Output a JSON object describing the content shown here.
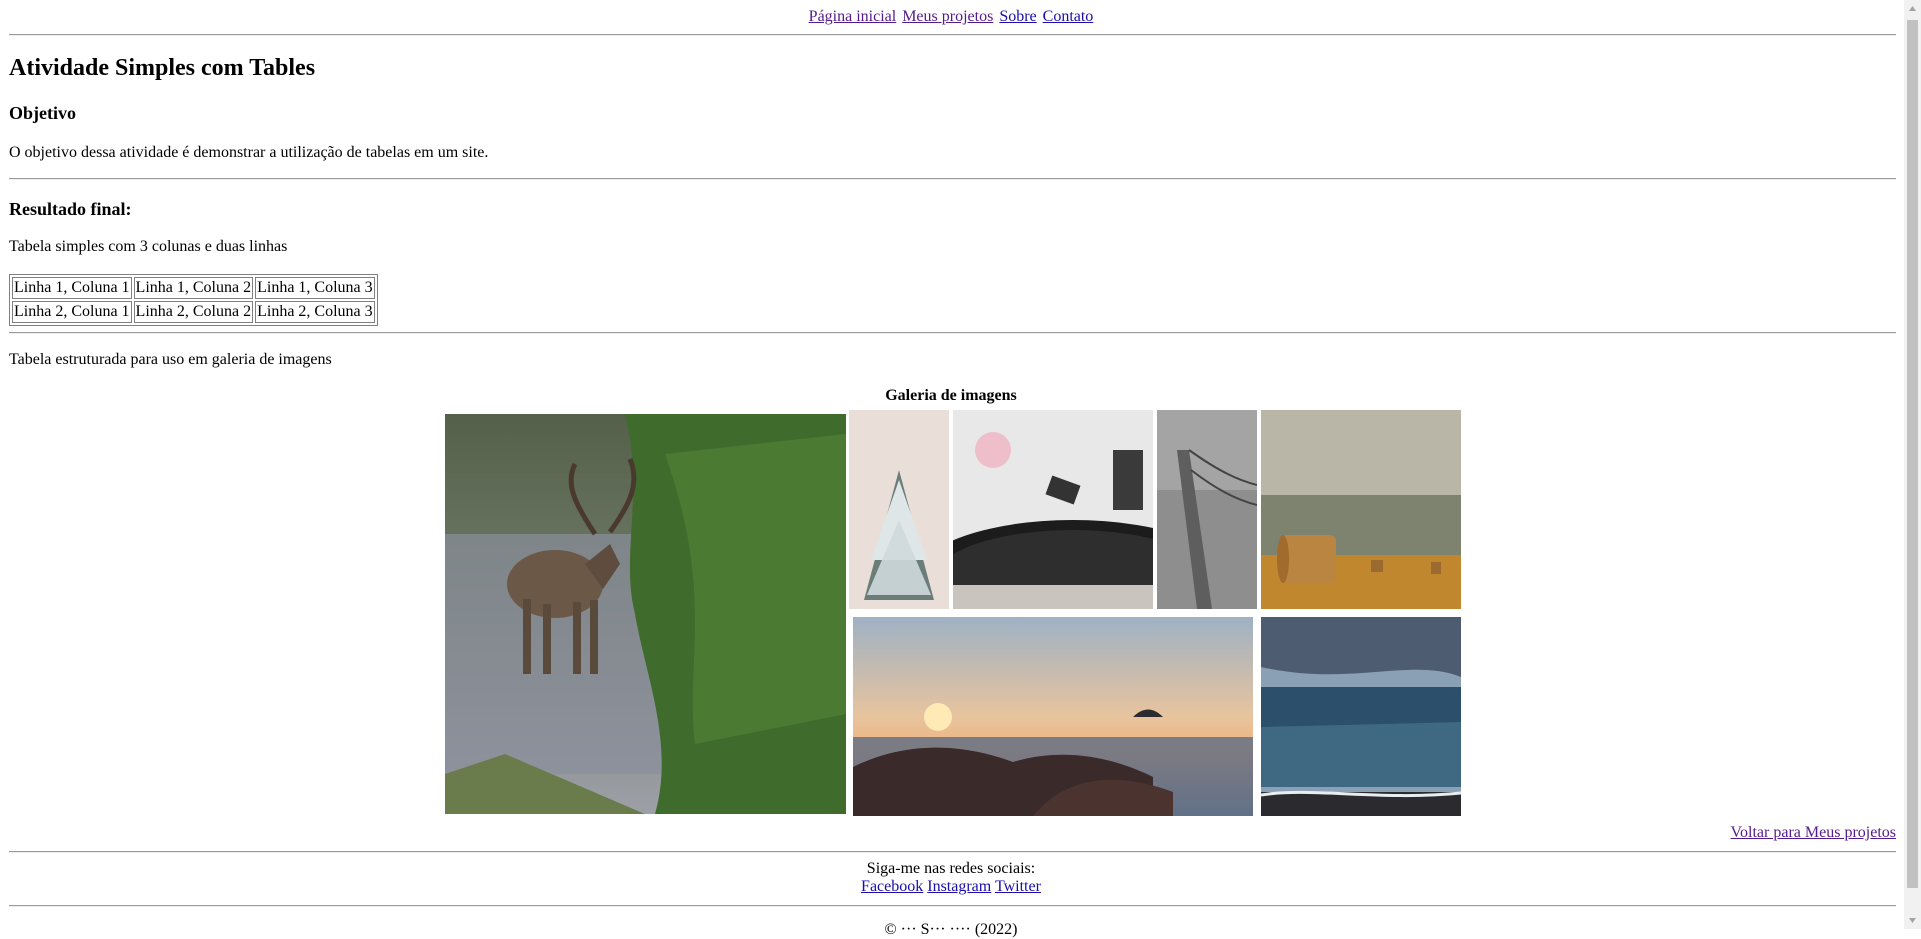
{
  "nav": {
    "home": "Página inicial",
    "projects": "Meus projetos",
    "about": "Sobre",
    "contact": "Contato"
  },
  "main": {
    "title": "Atividade Simples com Tables",
    "objective_heading": "Objetivo",
    "objective_text": "O objetivo dessa atividade é demonstrar a utilização de tabelas em um site.",
    "result_heading": "Resultado final:",
    "simple_table_caption": "Tabela simples com 3 colunas e duas linhas",
    "simple_table": [
      [
        "Linha 1, Coluna 1",
        "Linha 1, Coluna 2",
        "Linha 1, Coluna 3"
      ],
      [
        "Linha 2, Coluna 1",
        "Linha 2, Coluna 2",
        "Linha 2, Coluna 3"
      ]
    ],
    "gallery_intro": "Tabela estruturada para uso em galeria de imagens",
    "gallery_caption": "Galeria de imagens",
    "back_link": "Voltar para Meus projetos"
  },
  "gallery_images": [
    "reindeer-in-river-photo",
    "snowy-pine-photo",
    "record-player-photo",
    "bridge-cables-photo",
    "hay-bale-field-photo",
    "sunset-beach-rocks-photo",
    "stormy-sea-photo"
  ],
  "footer": {
    "follow_text": "Siga-me nas redes sociais:",
    "facebook": "Facebook",
    "instagram": "Instagram",
    "twitter": "Twitter",
    "copyright": "© ··· S··· ···· (2022)"
  },
  "colors": {
    "link": "#1a0dab",
    "visited_link": "#551a8b"
  }
}
